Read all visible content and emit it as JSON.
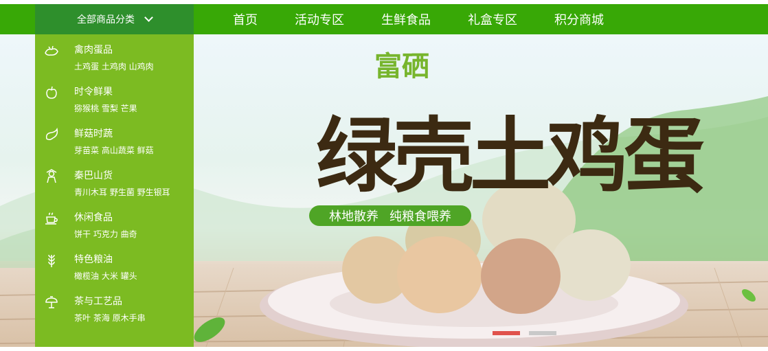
{
  "colors": {
    "nav_bg": "#38a806",
    "category_trigger_bg": "#2e8f2c",
    "sidebar_bg": "#7cbb22",
    "slider_active": "#e0524c",
    "slider_inactive": "#c9c9c9"
  },
  "category_menu": {
    "label": "全部商品分类",
    "icon": "chevron-down-icon"
  },
  "nav": [
    "首页",
    "活动专区",
    "生鲜食品",
    "礼盒专区",
    "积分商城"
  ],
  "categories": [
    {
      "title": "禽肉蛋品",
      "sub": "土鸡蛋 土鸡肉 山鸡肉",
      "icon": "poultry-icon"
    },
    {
      "title": "时令鲜果",
      "sub": "猕猴桃 雪梨 芒果",
      "icon": "apple-icon"
    },
    {
      "title": "鲜菇时蔬",
      "sub": "芽苗菜 高山蔬菜 鲜菇",
      "icon": "eggplant-icon"
    },
    {
      "title": "秦巴山货",
      "sub": "青川木耳 野生菌 野生银耳",
      "icon": "farmer-icon"
    },
    {
      "title": "休闲食品",
      "sub": "饼干 巧克力 曲奇",
      "icon": "tea-cup-icon"
    },
    {
      "title": "特色粮油",
      "sub": "橄榄油  大米 罐头",
      "icon": "wheat-icon"
    },
    {
      "title": "茶与工艺品",
      "sub": "茶叶 茶海 原木手串",
      "icon": "teapot-icon"
    }
  ],
  "banner": {
    "brand": "富硒",
    "headline": "绿壳土鸡蛋",
    "tag_left": "林地散养",
    "tag_right": "纯粮食喂养"
  },
  "slider": {
    "count": 2,
    "active": 1
  }
}
